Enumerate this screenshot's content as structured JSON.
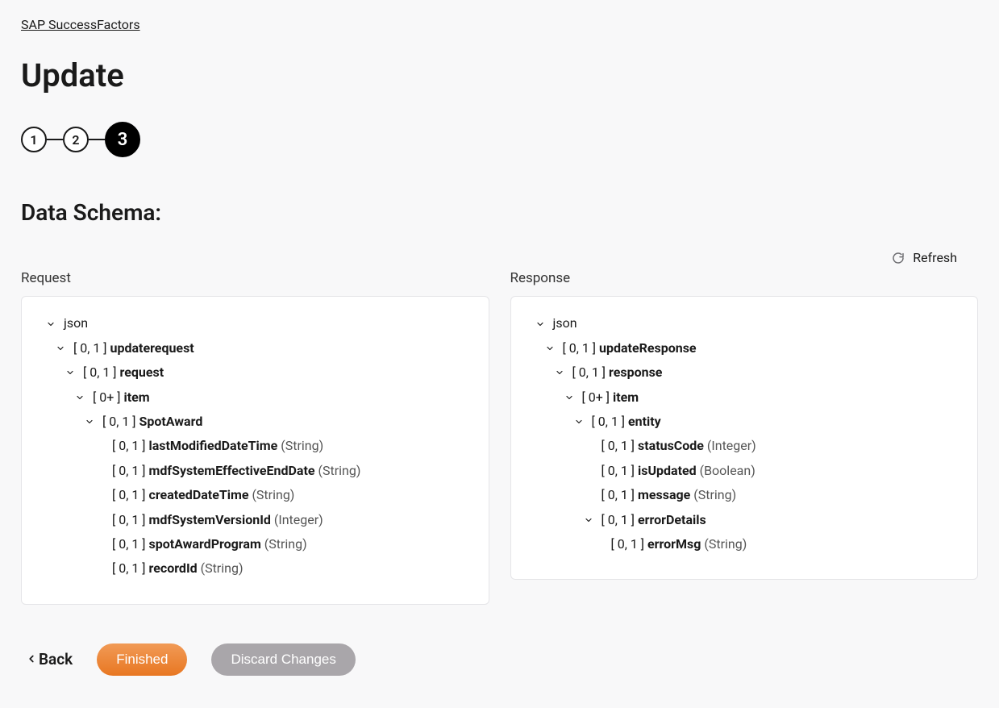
{
  "breadcrumb": {
    "label": "SAP SuccessFactors"
  },
  "page": {
    "title": "Update"
  },
  "stepper": {
    "steps": [
      {
        "number": "1",
        "active": false
      },
      {
        "number": "2",
        "active": false
      },
      {
        "number": "3",
        "active": true
      }
    ]
  },
  "section": {
    "title": "Data Schema:"
  },
  "refresh": {
    "label": "Refresh"
  },
  "columns": {
    "request": {
      "header": "Request"
    },
    "response": {
      "header": "Response"
    }
  },
  "tree": {
    "request": [
      {
        "indent": 0,
        "expandable": true,
        "bracket": "",
        "name": "json",
        "nameBold": false,
        "type": ""
      },
      {
        "indent": 1,
        "expandable": true,
        "bracket": "[ 0, 1 ] ",
        "name": "updaterequest",
        "nameBold": true,
        "type": ""
      },
      {
        "indent": 2,
        "expandable": true,
        "bracket": "[ 0, 1 ] ",
        "name": "request",
        "nameBold": true,
        "type": ""
      },
      {
        "indent": 3,
        "expandable": true,
        "bracket": "[ 0+ ] ",
        "name": "item",
        "nameBold": true,
        "type": ""
      },
      {
        "indent": 4,
        "expandable": true,
        "bracket": "[ 0, 1 ] ",
        "name": "SpotAward",
        "nameBold": true,
        "type": ""
      },
      {
        "indent": 5,
        "expandable": false,
        "bracket": "[ 0, 1 ] ",
        "name": "lastModifiedDateTime",
        "nameBold": true,
        "type": " (String)"
      },
      {
        "indent": 5,
        "expandable": false,
        "bracket": "[ 0, 1 ] ",
        "name": "mdfSystemEffectiveEndDate",
        "nameBold": true,
        "type": " (String)"
      },
      {
        "indent": 5,
        "expandable": false,
        "bracket": "[ 0, 1 ] ",
        "name": "createdDateTime",
        "nameBold": true,
        "type": " (String)"
      },
      {
        "indent": 5,
        "expandable": false,
        "bracket": "[ 0, 1 ] ",
        "name": "mdfSystemVersionId",
        "nameBold": true,
        "type": " (Integer)"
      },
      {
        "indent": 5,
        "expandable": false,
        "bracket": "[ 0, 1 ] ",
        "name": "spotAwardProgram",
        "nameBold": true,
        "type": " (String)"
      },
      {
        "indent": 5,
        "expandable": false,
        "bracket": "[ 0, 1 ] ",
        "name": "recordId",
        "nameBold": true,
        "type": " (String)"
      }
    ],
    "response": [
      {
        "indent": 0,
        "expandable": true,
        "bracket": "",
        "name": "json",
        "nameBold": false,
        "type": ""
      },
      {
        "indent": 1,
        "expandable": true,
        "bracket": "[ 0, 1 ] ",
        "name": "updateResponse",
        "nameBold": true,
        "type": ""
      },
      {
        "indent": 2,
        "expandable": true,
        "bracket": "[ 0, 1 ] ",
        "name": "response",
        "nameBold": true,
        "type": ""
      },
      {
        "indent": 3,
        "expandable": true,
        "bracket": "[ 0+ ] ",
        "name": "item",
        "nameBold": true,
        "type": ""
      },
      {
        "indent": 4,
        "expandable": true,
        "bracket": "[ 0, 1 ] ",
        "name": "entity",
        "nameBold": true,
        "type": ""
      },
      {
        "indent": 5,
        "expandable": false,
        "bracket": "[ 0, 1 ] ",
        "name": "statusCode",
        "nameBold": true,
        "type": " (Integer)"
      },
      {
        "indent": 5,
        "expandable": false,
        "bracket": "[ 0, 1 ] ",
        "name": "isUpdated",
        "nameBold": true,
        "type": " (Boolean)"
      },
      {
        "indent": 5,
        "expandable": false,
        "bracket": "[ 0, 1 ] ",
        "name": "message",
        "nameBold": true,
        "type": " (String)"
      },
      {
        "indent": 5,
        "expandable": true,
        "bracket": "[ 0, 1 ] ",
        "name": "errorDetails",
        "nameBold": true,
        "type": ""
      },
      {
        "indent": 6,
        "expandable": false,
        "bracket": "[ 0, 1 ] ",
        "name": "errorMsg",
        "nameBold": true,
        "type": " (String)"
      }
    ]
  },
  "footer": {
    "back": "Back",
    "finished": "Finished",
    "discard": "Discard Changes"
  }
}
